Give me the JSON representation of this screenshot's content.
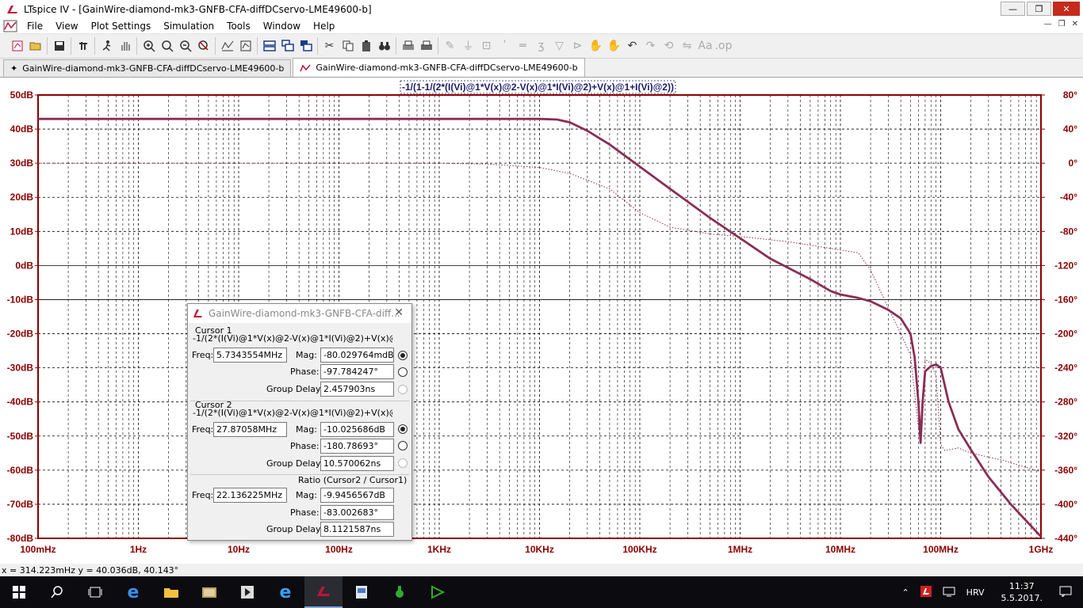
{
  "window": {
    "title": "LTspice IV - [GainWire-diamond-mk3-GNFB-CFA-diffDCservo-LME49600-b]",
    "minimize": "—",
    "maximize": "❐",
    "close": "✕"
  },
  "menu": {
    "items": [
      "File",
      "View",
      "Plot Settings",
      "Simulation",
      "Tools",
      "Window",
      "Help"
    ],
    "mdi_minimize": "—",
    "mdi_restore": "❐",
    "mdi_close": "✕"
  },
  "tabs": [
    {
      "label": "GainWire-diamond-mk3-GNFB-CFA-diffDCservo-LME49600-b",
      "icon": "schematic-icon"
    },
    {
      "label": "GainWire-diamond-mk3-GNFB-CFA-diffDCservo-LME49600-b",
      "icon": "waveform-icon"
    }
  ],
  "plot": {
    "trace_title": "-1/(1-1/(2*(I(Vi)@1*V(x)@2-V(x)@1*I(Vi)@2)+V(x)@1+I(Vi)@2))",
    "colors": {
      "trace": "#8b2d55",
      "axis": "#8b0000",
      "phase_axis": "#8b0000",
      "grid": "#000000"
    }
  },
  "chart_data": {
    "type": "line",
    "title": "-1/(1-1/(2*(I(Vi)@1*V(x)@2-V(x)@1*I(Vi)@2)+V(x)@1+I(Vi)@2))",
    "xscale": "log",
    "xlim": [
      0.1,
      1000000000
    ],
    "x_ticks": [
      "100mHz",
      "1Hz",
      "10Hz",
      "100Hz",
      "1KHz",
      "10KHz",
      "100KHz",
      "1MHz",
      "10MHz",
      "100MHz",
      "1GHz"
    ],
    "x_tick_values": [
      0.1,
      1,
      10,
      100,
      1000,
      10000,
      100000,
      1000000,
      10000000,
      100000000,
      1000000000
    ],
    "ylim": [
      -80,
      50
    ],
    "y_ticks": [
      "50dB",
      "40dB",
      "30dB",
      "20dB",
      "10dB",
      "0dB",
      "-10dB",
      "-20dB",
      "-30dB",
      "-40dB",
      "-50dB",
      "-60dB",
      "-70dB",
      "-80dB"
    ],
    "y_tick_values": [
      50,
      40,
      30,
      20,
      10,
      0,
      -10,
      -20,
      -30,
      -40,
      -50,
      -60,
      -70,
      -80
    ],
    "y2lim": [
      -440,
      80
    ],
    "y2_ticks": [
      "80°",
      "40°",
      "0°",
      "-40°",
      "-80°",
      "-120°",
      "-160°",
      "-200°",
      "-240°",
      "-280°",
      "-320°",
      "-360°",
      "-400°",
      "-440°"
    ],
    "y2_tick_values": [
      80,
      40,
      0,
      -40,
      -80,
      -120,
      -160,
      -200,
      -240,
      -280,
      -320,
      -360,
      -400,
      -440
    ],
    "grid": true,
    "series": [
      {
        "style": "solid",
        "points": [
          [
            0.1,
            43
          ],
          [
            1000,
            43
          ],
          [
            10000,
            43
          ],
          [
            15000,
            42.8
          ],
          [
            20000,
            42
          ],
          [
            30000,
            39.5
          ],
          [
            50000,
            35.5
          ],
          [
            100000,
            29
          ],
          [
            200000,
            22.5
          ],
          [
            500000,
            14
          ],
          [
            1000000,
            8
          ],
          [
            2000000,
            2
          ],
          [
            5000000,
            -4
          ],
          [
            8000000,
            -7.5
          ],
          [
            10000000,
            -8.5
          ],
          [
            15000000,
            -9.5
          ],
          [
            20000000,
            -10.5
          ],
          [
            30000000,
            -13
          ],
          [
            40000000,
            -15.5
          ],
          [
            50000000,
            -20
          ],
          [
            55000000,
            -27
          ],
          [
            60000000,
            -40
          ],
          [
            63000000,
            -52
          ],
          [
            66000000,
            -40
          ],
          [
            70000000,
            -31
          ],
          [
            80000000,
            -29.5
          ],
          [
            90000000,
            -29
          ],
          [
            100000000,
            -30
          ],
          [
            120000000,
            -40
          ],
          [
            150000000,
            -48
          ],
          [
            200000000,
            -54
          ],
          [
            300000000,
            -62
          ],
          [
            500000000,
            -70
          ],
          [
            1000000000,
            -79.5
          ]
        ]
      },
      {
        "style": "dotted",
        "axis": "y2",
        "points": [
          [
            0.1,
            0
          ],
          [
            1000,
            0
          ],
          [
            3000,
            -1
          ],
          [
            10000,
            -5
          ],
          [
            20000,
            -12
          ],
          [
            50000,
            -30
          ],
          [
            100000,
            -58
          ],
          [
            200000,
            -75
          ],
          [
            500000,
            -83
          ],
          [
            1000000,
            -86
          ],
          [
            3000000,
            -92
          ],
          [
            8000000,
            -100
          ],
          [
            15000000,
            -105
          ],
          [
            20000000,
            -125
          ],
          [
            30000000,
            -170
          ],
          [
            40000000,
            -200
          ],
          [
            50000000,
            -225
          ],
          [
            55000000,
            -270
          ],
          [
            60000000,
            -310
          ],
          [
            63000000,
            -320
          ],
          [
            66000000,
            -300
          ],
          [
            70000000,
            -230
          ],
          [
            80000000,
            -235
          ],
          [
            90000000,
            -250
          ],
          [
            100000000,
            -330
          ],
          [
            110000000,
            -337
          ],
          [
            150000000,
            -334
          ],
          [
            200000000,
            -340
          ],
          [
            400000000,
            -348
          ],
          [
            1000000000,
            -362
          ]
        ]
      }
    ]
  },
  "cursor_dialog": {
    "title": "GainWire-diamond-mk3-GNFB-CFA-diff...",
    "close": "✕",
    "cursor1": {
      "heading": "Cursor 1",
      "expr": "-1/(2*(I(Vi)@1*V(x)@2-V(x)@1*I(Vi)@2)+V(x)@1+I(Vi)",
      "freq_label": "Freq:",
      "freq": "5.7343554MHz",
      "mag_label": "Mag:",
      "mag": "-80.029764mdB",
      "phase_label": "Phase:",
      "phase": "-97.784247°",
      "gd_label": "Group Delay:",
      "gd": "2.457903ns"
    },
    "cursor2": {
      "heading": "Cursor 2",
      "expr": "-1/(2*(I(Vi)@1*V(x)@2-V(x)@1*I(Vi)@2)+V(x)@1+I(Vi)",
      "freq_label": "Freq:",
      "freq": "27.87058MHz",
      "mag_label": "Mag:",
      "mag": "-10.025686dB",
      "phase_label": "Phase:",
      "phase": "-180.78693°",
      "gd_label": "Group Delay:",
      "gd": "10.570062ns"
    },
    "ratio": {
      "heading": "Ratio (Cursor2 / Cursor1)",
      "freq_label": "Freq:",
      "freq": "22.136225MHz",
      "mag_label": "Mag:",
      "mag": "-9.9456567dB",
      "phase_label": "Phase:",
      "phase": "-83.002683°",
      "gd_label": "Group Delay:",
      "gd": "8.1121587ns"
    }
  },
  "status": {
    "coords": "x = 314.223mHz    y = 40.036dB, 40.143°"
  },
  "taskbar": {
    "lang": "HRV",
    "time": "11:37",
    "date": "5.5.2017."
  }
}
